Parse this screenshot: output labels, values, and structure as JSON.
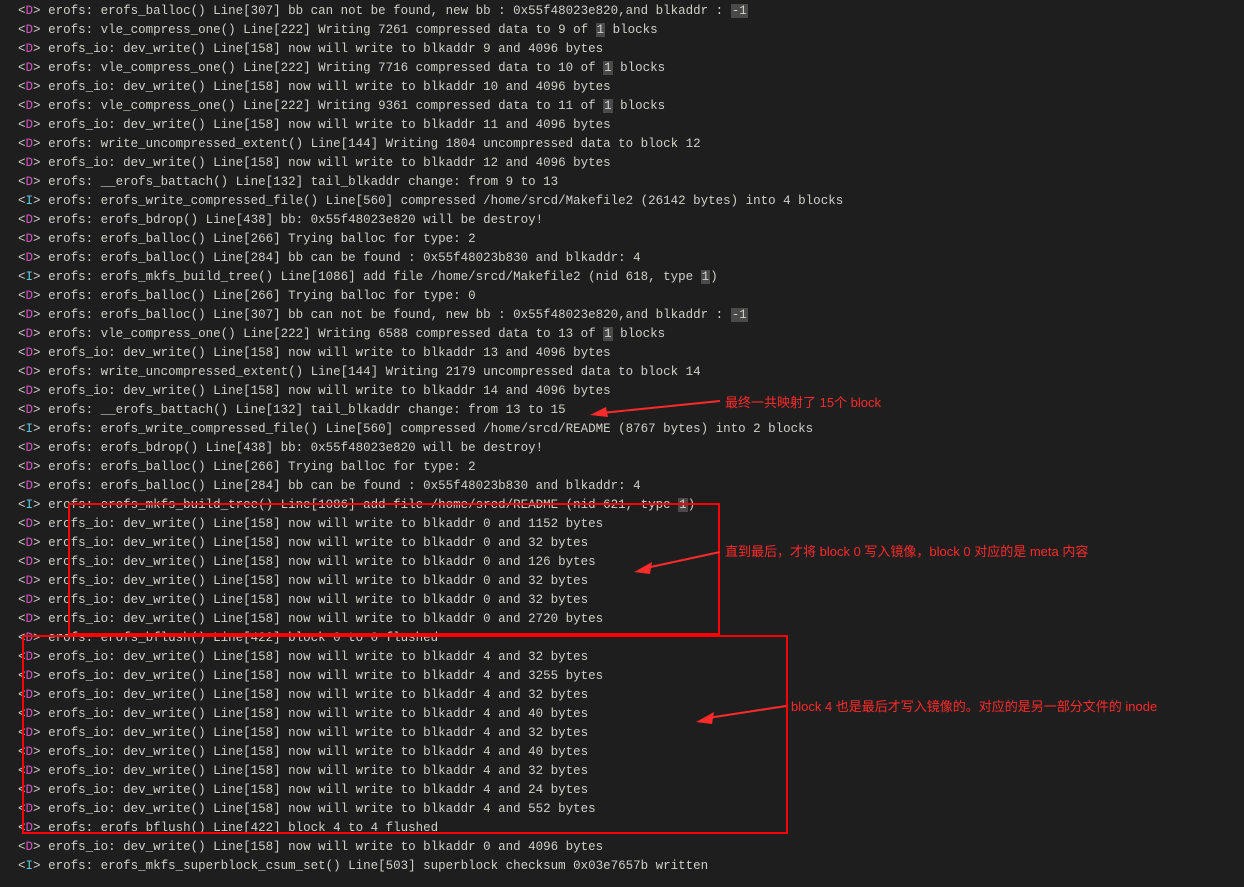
{
  "annotations": {
    "a1": "最终一共映射了 15个 block",
    "a2": "直到最后，才将 block 0 写入镜像，block 0 对应的是 meta 内容",
    "a3": "block 4 也是最后才写入镜像的。对应的是另一部分文件的 inode"
  },
  "log_lines": [
    {
      "tag": "D",
      "pre": "erofs: erofs_balloc() Line[307] bb can not be found, new bb : 0x55f48023e820,and blkaddr : ",
      "hl": "-1",
      "post": ""
    },
    {
      "tag": "D",
      "pre": "erofs: vle_compress_one() Line[222] Writing 7261 compressed data to 9 of ",
      "hl": "1",
      "post": " blocks"
    },
    {
      "tag": "D",
      "pre": "erofs_io: dev_write() Line[158] now will write to blkaddr 9 and 4096 bytes",
      "hl": "",
      "post": ""
    },
    {
      "tag": "D",
      "pre": "erofs: vle_compress_one() Line[222] Writing 7716 compressed data to 10 of ",
      "hl": "1",
      "post": " blocks"
    },
    {
      "tag": "D",
      "pre": "erofs_io: dev_write() Line[158] now will write to blkaddr 10 and 4096 bytes",
      "hl": "",
      "post": ""
    },
    {
      "tag": "D",
      "pre": "erofs: vle_compress_one() Line[222] Writing 9361 compressed data to 11 of ",
      "hl": "1",
      "post": " blocks"
    },
    {
      "tag": "D",
      "pre": "erofs_io: dev_write() Line[158] now will write to blkaddr 11 and 4096 bytes",
      "hl": "",
      "post": ""
    },
    {
      "tag": "D",
      "pre": "erofs: write_uncompressed_extent() Line[144] Writing 1804 uncompressed data to block 12",
      "hl": "",
      "post": ""
    },
    {
      "tag": "D",
      "pre": "erofs_io: dev_write() Line[158] now will write to blkaddr 12 and 4096 bytes",
      "hl": "",
      "post": ""
    },
    {
      "tag": "D",
      "pre": "erofs: __erofs_battach() Line[132] tail_blkaddr change: from 9 to 13",
      "hl": "",
      "post": ""
    },
    {
      "tag": "I",
      "pre": "erofs: erofs_write_compressed_file() Line[560] compressed /home/srcd/Makefile2 (26142 bytes) into 4 blocks",
      "hl": "",
      "post": ""
    },
    {
      "tag": "D",
      "pre": "erofs: erofs_bdrop() Line[438] bb: 0x55f48023e820 will be destroy!",
      "hl": "",
      "post": ""
    },
    {
      "tag": "D",
      "pre": "erofs: erofs_balloc() Line[266] Trying balloc for type: 2",
      "hl": "",
      "post": ""
    },
    {
      "tag": "D",
      "pre": "erofs: erofs_balloc() Line[284] bb can be found : 0x55f48023b830 and blkaddr: 4",
      "hl": "",
      "post": ""
    },
    {
      "tag": "I",
      "pre": "erofs: erofs_mkfs_build_tree() Line[1086] add file /home/srcd/Makefile2 (nid 618, type ",
      "hl": "1",
      "post": ")"
    },
    {
      "tag": "D",
      "pre": "erofs: erofs_balloc() Line[266] Trying balloc for type: 0",
      "hl": "",
      "post": ""
    },
    {
      "tag": "D",
      "pre": "erofs: erofs_balloc() Line[307] bb can not be found, new bb : 0x55f48023e820,and blkaddr : ",
      "hl": "-1",
      "post": ""
    },
    {
      "tag": "D",
      "pre": "erofs: vle_compress_one() Line[222] Writing 6588 compressed data to 13 of ",
      "hl": "1",
      "post": " blocks"
    },
    {
      "tag": "D",
      "pre": "erofs_io: dev_write() Line[158] now will write to blkaddr 13 and 4096 bytes",
      "hl": "",
      "post": ""
    },
    {
      "tag": "D",
      "pre": "erofs: write_uncompressed_extent() Line[144] Writing 2179 uncompressed data to block 14",
      "hl": "",
      "post": ""
    },
    {
      "tag": "D",
      "pre": "erofs_io: dev_write() Line[158] now will write to blkaddr 14 and 4096 bytes",
      "hl": "",
      "post": ""
    },
    {
      "tag": "D",
      "pre": "erofs: __erofs_battach() Line[132] tail_blkaddr change: from 13 to 15",
      "hl": "",
      "post": ""
    },
    {
      "tag": "I",
      "pre": "erofs: erofs_write_compressed_file() Line[560] compressed /home/srcd/README (8767 bytes) into 2 blocks",
      "hl": "",
      "post": ""
    },
    {
      "tag": "D",
      "pre": "erofs: erofs_bdrop() Line[438] bb: 0x55f48023e820 will be destroy!",
      "hl": "",
      "post": ""
    },
    {
      "tag": "D",
      "pre": "erofs: erofs_balloc() Line[266] Trying balloc for type: 2",
      "hl": "",
      "post": ""
    },
    {
      "tag": "D",
      "pre": "erofs: erofs_balloc() Line[284] bb can be found : 0x55f48023b830 and blkaddr: 4",
      "hl": "",
      "post": ""
    },
    {
      "tag": "I",
      "pre": "erofs: erofs_mkfs_build_tree() Line[1086] add file /home/srcd/README (nid 621, type ",
      "hl": "1",
      "post": ")"
    },
    {
      "tag": "D",
      "pre": "erofs_io: dev_write() Line[158] now will write to blkaddr 0 and 1152 bytes",
      "hl": "",
      "post": ""
    },
    {
      "tag": "D",
      "pre": "erofs_io: dev_write() Line[158] now will write to blkaddr 0 and 32 bytes",
      "hl": "",
      "post": ""
    },
    {
      "tag": "D",
      "pre": "erofs_io: dev_write() Line[158] now will write to blkaddr 0 and 126 bytes",
      "hl": "",
      "post": ""
    },
    {
      "tag": "D",
      "pre": "erofs_io: dev_write() Line[158] now will write to blkaddr 0 and 32 bytes",
      "hl": "",
      "post": ""
    },
    {
      "tag": "D",
      "pre": "erofs_io: dev_write() Line[158] now will write to blkaddr 0 and 32 bytes",
      "hl": "",
      "post": ""
    },
    {
      "tag": "D",
      "pre": "erofs_io: dev_write() Line[158] now will write to blkaddr 0 and 2720 bytes",
      "hl": "",
      "post": ""
    },
    {
      "tag": "D",
      "pre": "erofs: erofs_bflush() Line[422] block 0 to 0 flushed",
      "hl": "",
      "post": ""
    },
    {
      "tag": "D",
      "pre": "erofs_io: dev_write() Line[158] now will write to blkaddr 4 and 32 bytes",
      "hl": "",
      "post": ""
    },
    {
      "tag": "D",
      "pre": "erofs_io: dev_write() Line[158] now will write to blkaddr 4 and 3255 bytes",
      "hl": "",
      "post": ""
    },
    {
      "tag": "D",
      "pre": "erofs_io: dev_write() Line[158] now will write to blkaddr 4 and 32 bytes",
      "hl": "",
      "post": ""
    },
    {
      "tag": "D",
      "pre": "erofs_io: dev_write() Line[158] now will write to blkaddr 4 and 40 bytes",
      "hl": "",
      "post": ""
    },
    {
      "tag": "D",
      "pre": "erofs_io: dev_write() Line[158] now will write to blkaddr 4 and 32 bytes",
      "hl": "",
      "post": ""
    },
    {
      "tag": "D",
      "pre": "erofs_io: dev_write() Line[158] now will write to blkaddr 4 and 40 bytes",
      "hl": "",
      "post": ""
    },
    {
      "tag": "D",
      "pre": "erofs_io: dev_write() Line[158] now will write to blkaddr 4 and 32 bytes",
      "hl": "",
      "post": ""
    },
    {
      "tag": "D",
      "pre": "erofs_io: dev_write() Line[158] now will write to blkaddr 4 and 24 bytes",
      "hl": "",
      "post": ""
    },
    {
      "tag": "D",
      "pre": "erofs_io: dev_write() Line[158] now will write to blkaddr 4 and 552 bytes",
      "hl": "",
      "post": ""
    },
    {
      "tag": "D",
      "pre": "erofs: erofs_bflush() Line[422] block 4 to 4 flushed",
      "hl": "",
      "post": ""
    },
    {
      "tag": "D",
      "pre": "erofs_io: dev_write() Line[158] now will write to blkaddr 0 and 4096 bytes",
      "hl": "",
      "post": ""
    },
    {
      "tag": "I",
      "pre": "erofs: erofs_mkfs_superblock_csum_set() Line[503] superblock checksum 0x03e7657b written",
      "hl": "",
      "post": ""
    }
  ]
}
